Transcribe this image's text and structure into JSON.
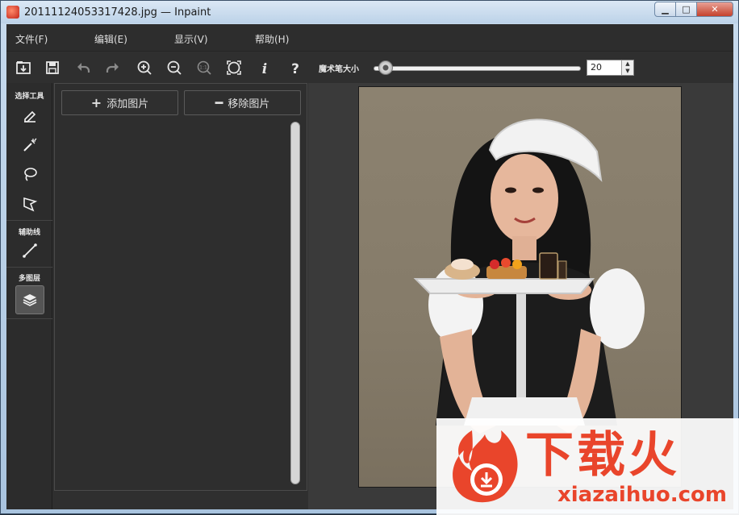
{
  "window": {
    "title": "20111124053317428.jpg — Inpaint",
    "controls": {
      "minimize": "▁",
      "maximize": "□",
      "close": "✕"
    }
  },
  "menu": [
    {
      "label": "文件(F)"
    },
    {
      "label": "编辑(E)"
    },
    {
      "label": "显示(V)"
    },
    {
      "label": "帮助(H)"
    }
  ],
  "toolbar": {
    "buttons": [
      {
        "name": "open-icon"
      },
      {
        "name": "save-icon"
      },
      {
        "name": "undo-icon"
      },
      {
        "name": "redo-icon"
      },
      {
        "name": "zoom-in-icon"
      },
      {
        "name": "zoom-out-icon"
      },
      {
        "name": "actual-size-icon"
      },
      {
        "name": "fit-window-icon"
      },
      {
        "name": "info-icon"
      },
      {
        "name": "help-icon"
      }
    ],
    "brush_size_label": "魔术笔大小",
    "brush_size_value": "20",
    "brush_size_slider_fraction": 0.06
  },
  "sidebar": {
    "select_tools_label": "选择工具",
    "guides_label": "辅助线",
    "layers_label": "多图层",
    "tools": [
      {
        "name": "marker-icon"
      },
      {
        "name": "magic-wand-icon"
      },
      {
        "name": "lasso-icon"
      },
      {
        "name": "polygon-lasso-icon"
      },
      {
        "name": "guide-line-icon"
      },
      {
        "name": "layers-icon"
      }
    ]
  },
  "image_list": {
    "add_button": "添加图片",
    "remove_button": "移除图片",
    "add_symbol": "+",
    "remove_symbol": "━"
  },
  "watermark": {
    "cn": "下载火",
    "en": "xiazaihuo.com"
  },
  "colors": {
    "brand": "#e9452b",
    "panel_bg": "#2e2e2e",
    "canvas_bg": "#3a3a3a"
  }
}
